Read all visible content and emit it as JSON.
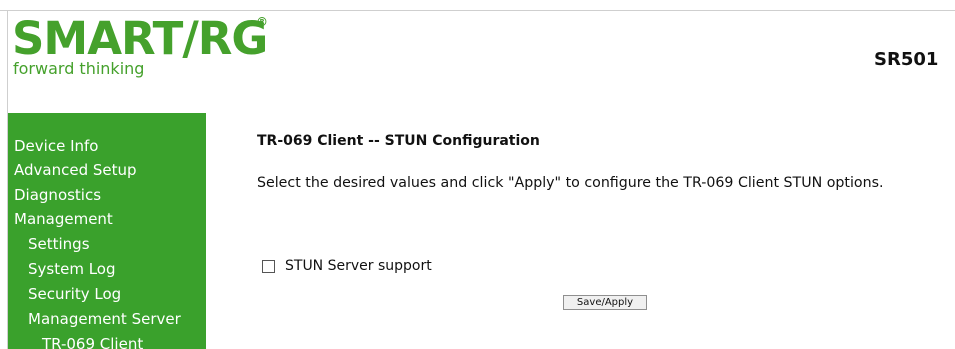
{
  "header": {
    "logo_text": "SMART/RG",
    "logo_registered": "®",
    "tagline": "forward thinking",
    "model": "SR501"
  },
  "sidebar": {
    "items": [
      {
        "label": "Device Info"
      },
      {
        "label": "Advanced Setup"
      },
      {
        "label": "Diagnostics"
      },
      {
        "label": "Management"
      },
      {
        "label": "Settings"
      },
      {
        "label": "System Log"
      },
      {
        "label": "Security Log"
      },
      {
        "label": "Management Server"
      },
      {
        "label": "TR-069 Client"
      }
    ]
  },
  "main": {
    "title": "TR-069 Client -- STUN Configuration",
    "instructions": "Select the desired values and click \"Apply\" to configure the TR-069 Client STUN options.",
    "stun_checkbox_label": "STUN Server support",
    "stun_checked": false,
    "apply_button": "Save/Apply"
  },
  "colors": {
    "brand_green": "#45a12c",
    "sidebar_green": "#3aa12c"
  }
}
